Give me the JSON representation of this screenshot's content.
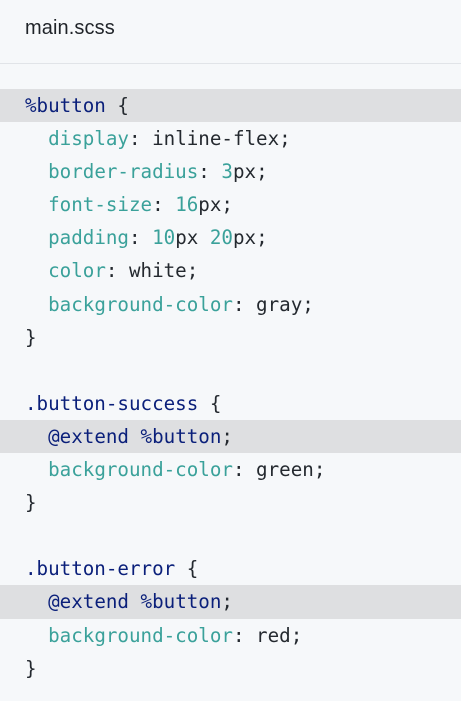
{
  "file": {
    "name": "main.scss"
  },
  "code": {
    "lines": [
      {
        "tokens": [
          {
            "t": "%button",
            "c": "sel-placeholder"
          },
          {
            "t": " {",
            "c": "plain"
          }
        ],
        "highlight": true
      },
      {
        "tokens": [
          {
            "t": "  ",
            "c": "plain"
          },
          {
            "t": "display",
            "c": "prop"
          },
          {
            "t": ": inline-flex;",
            "c": "plain"
          }
        ],
        "highlight": false
      },
      {
        "tokens": [
          {
            "t": "  ",
            "c": "plain"
          },
          {
            "t": "border-radius",
            "c": "prop"
          },
          {
            "t": ": ",
            "c": "plain"
          },
          {
            "t": "3",
            "c": "num"
          },
          {
            "t": "px;",
            "c": "plain"
          }
        ],
        "highlight": false
      },
      {
        "tokens": [
          {
            "t": "  ",
            "c": "plain"
          },
          {
            "t": "font-size",
            "c": "prop"
          },
          {
            "t": ": ",
            "c": "plain"
          },
          {
            "t": "16",
            "c": "num"
          },
          {
            "t": "px;",
            "c": "plain"
          }
        ],
        "highlight": false
      },
      {
        "tokens": [
          {
            "t": "  ",
            "c": "plain"
          },
          {
            "t": "padding",
            "c": "prop"
          },
          {
            "t": ": ",
            "c": "plain"
          },
          {
            "t": "10",
            "c": "num"
          },
          {
            "t": "px ",
            "c": "plain"
          },
          {
            "t": "20",
            "c": "num"
          },
          {
            "t": "px;",
            "c": "plain"
          }
        ],
        "highlight": false
      },
      {
        "tokens": [
          {
            "t": "  ",
            "c": "plain"
          },
          {
            "t": "color",
            "c": "prop"
          },
          {
            "t": ": white;",
            "c": "plain"
          }
        ],
        "highlight": false
      },
      {
        "tokens": [
          {
            "t": "  ",
            "c": "plain"
          },
          {
            "t": "background-color",
            "c": "prop"
          },
          {
            "t": ": gray;",
            "c": "plain"
          }
        ],
        "highlight": false
      },
      {
        "tokens": [
          {
            "t": "}",
            "c": "plain"
          }
        ],
        "highlight": false
      },
      {
        "tokens": [
          {
            "t": "",
            "c": "plain"
          }
        ],
        "highlight": false
      },
      {
        "tokens": [
          {
            "t": ".button-success",
            "c": "sel"
          },
          {
            "t": " {",
            "c": "plain"
          }
        ],
        "highlight": false
      },
      {
        "tokens": [
          {
            "t": "  ",
            "c": "plain"
          },
          {
            "t": "@extend",
            "c": "at"
          },
          {
            "t": " ",
            "c": "plain"
          },
          {
            "t": "%button",
            "c": "sel-placeholder"
          },
          {
            "t": ";",
            "c": "plain"
          }
        ],
        "highlight": true
      },
      {
        "tokens": [
          {
            "t": "  ",
            "c": "plain"
          },
          {
            "t": "background-color",
            "c": "prop"
          },
          {
            "t": ": green;",
            "c": "plain"
          }
        ],
        "highlight": false
      },
      {
        "tokens": [
          {
            "t": "}",
            "c": "plain"
          }
        ],
        "highlight": false
      },
      {
        "tokens": [
          {
            "t": "",
            "c": "plain"
          }
        ],
        "highlight": false
      },
      {
        "tokens": [
          {
            "t": ".button-error",
            "c": "sel"
          },
          {
            "t": " {",
            "c": "plain"
          }
        ],
        "highlight": false
      },
      {
        "tokens": [
          {
            "t": "  ",
            "c": "plain"
          },
          {
            "t": "@extend",
            "c": "at"
          },
          {
            "t": " ",
            "c": "plain"
          },
          {
            "t": "%button",
            "c": "sel-placeholder"
          },
          {
            "t": ";",
            "c": "plain"
          }
        ],
        "highlight": true
      },
      {
        "tokens": [
          {
            "t": "  ",
            "c": "plain"
          },
          {
            "t": "background-color",
            "c": "prop"
          },
          {
            "t": ": red;",
            "c": "plain"
          }
        ],
        "highlight": false
      },
      {
        "tokens": [
          {
            "t": "}",
            "c": "plain"
          }
        ],
        "highlight": false
      }
    ]
  },
  "colors": {
    "background": "#f6f8fa",
    "highlight_line": "#dedfe1",
    "selector": "#0a1f7a",
    "property": "#3aa19a",
    "text": "#24292f"
  }
}
